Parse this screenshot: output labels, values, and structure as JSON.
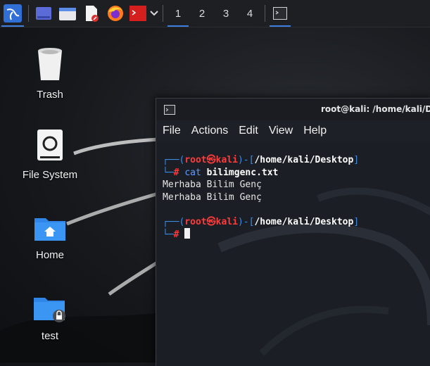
{
  "panel": {
    "icons": [
      "kali-menu-icon",
      "workspace-preview-icon",
      "file-manager-icon",
      "text-editor-icon",
      "firefox-icon",
      "terminal-icon",
      "chevron-down-icon"
    ],
    "workspaces": [
      "1",
      "2",
      "3",
      "4"
    ],
    "active_workspace": "1"
  },
  "desktop": {
    "icons": [
      {
        "label": "Trash",
        "icon": "trash-icon"
      },
      {
        "label": "File System",
        "icon": "drive-icon"
      },
      {
        "label": "Home",
        "icon": "home-folder-icon"
      },
      {
        "label": "test",
        "icon": "locked-folder-icon"
      }
    ]
  },
  "terminal": {
    "title": "root@kali: /home/kali/Desktop",
    "menu": [
      "File",
      "Actions",
      "Edit",
      "View",
      "Help"
    ],
    "prompt": {
      "user": "root",
      "at": "㉿",
      "host": "kali",
      "path": "/home/kali/Desktop",
      "symbol": "#"
    },
    "command": {
      "name": "cat",
      "arg": "bilimgenc.txt"
    },
    "output": [
      "Merhaba Bilim Genç",
      "Merhaba Bilim Genç"
    ]
  },
  "colors": {
    "panel_bg": "#1e1f22",
    "accent": "#3d7fe0",
    "prompt_blue": "#3b8ee8",
    "prompt_red": "#ff3b3b"
  }
}
